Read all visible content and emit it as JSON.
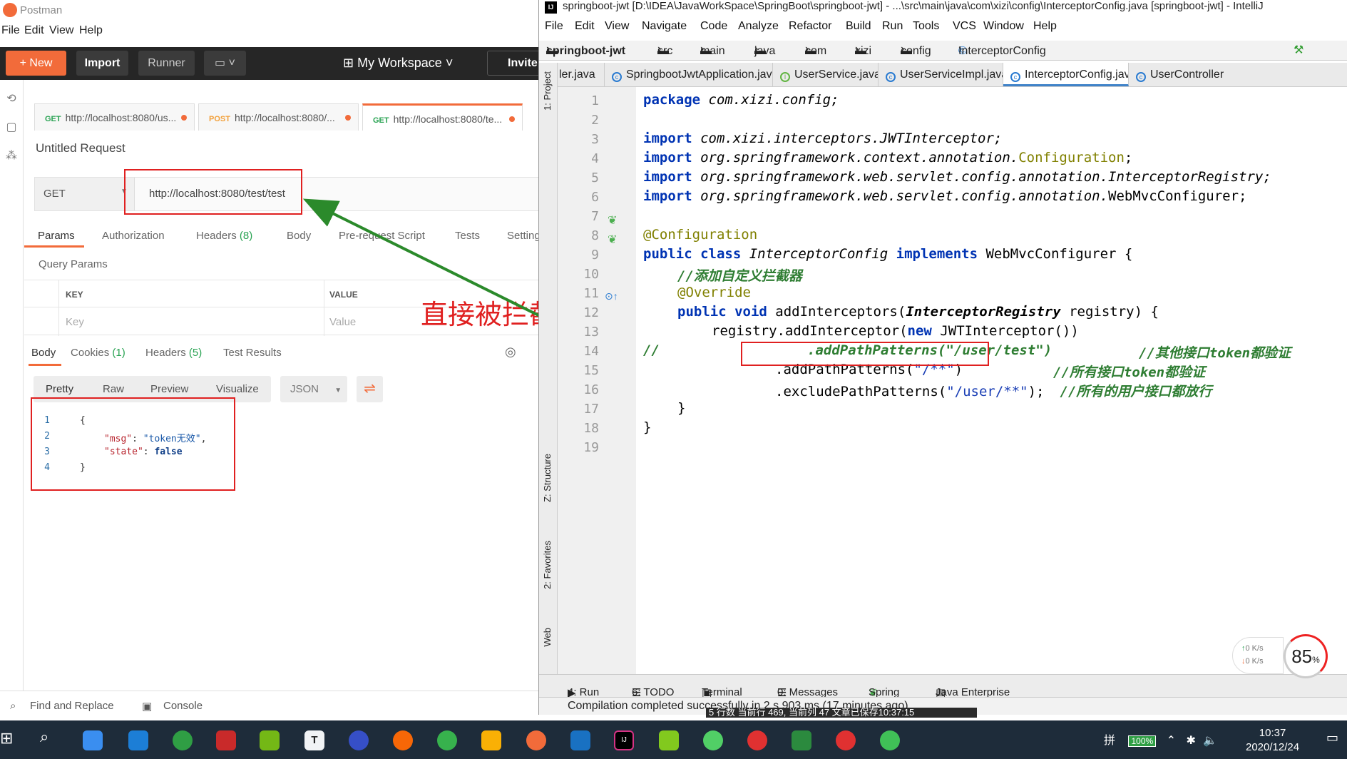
{
  "postman": {
    "app_title": "Postman",
    "menu": [
      "File",
      "Edit",
      "View",
      "Help"
    ],
    "toolbar": {
      "new_label": "New",
      "import_label": "Import",
      "runner_label": "Runner",
      "workspace_label": "My Workspace",
      "invite_label": "Invite"
    },
    "tabs": [
      {
        "method": "GET",
        "url": "http://localhost:8080/us..."
      },
      {
        "method": "POST",
        "url": "http://localhost:8080/..."
      },
      {
        "method": "GET",
        "url": "http://localhost:8080/te..."
      }
    ],
    "request_title": "Untitled Request",
    "method": "GET",
    "url": "http://localhost:8080/test/test",
    "subtabs": [
      "Params",
      "Authorization",
      "Headers",
      "(8)",
      "Body",
      "Pre-request Script",
      "Tests",
      "Settings"
    ],
    "query_params_label": "Query Params",
    "table": {
      "key_header": "KEY",
      "value_header": "VALUE",
      "key_placeholder": "Key",
      "value_placeholder": "Value"
    },
    "response_tabs": {
      "body": "Body",
      "cookies": "Cookies",
      "cookies_count": "(1)",
      "headers": "Headers",
      "headers_count": "(5)",
      "test_results": "Test Results"
    },
    "format_tabs": [
      "Pretty",
      "Raw",
      "Preview",
      "Visualize"
    ],
    "format_select": "JSON",
    "response_lines": [
      {
        "n": "1",
        "text": "{"
      },
      {
        "n": "2",
        "key": "\"msg\"",
        "value": "\"token无效\"",
        "sep": ": ",
        "end": ","
      },
      {
        "n": "3",
        "key": "\"state\"",
        "value": "false",
        "sep": ": ",
        "end": ""
      },
      {
        "n": "4",
        "text": "}"
      }
    ],
    "bottom": {
      "find_replace": "Find and Replace",
      "console": "Console"
    },
    "annotation": "直接被拦截"
  },
  "intellij": {
    "title": "springboot-jwt [D:\\IDEA\\JavaWorkSpace\\SpringBoot\\springboot-jwt] - ...\\src\\main\\java\\com\\xizi\\config\\InterceptorConfig.java [springboot-jwt] - IntelliJ",
    "menu": [
      "File",
      "Edit",
      "View",
      "Navigate",
      "Code",
      "Analyze",
      "Refactor",
      "Build",
      "Run",
      "Tools",
      "VCS",
      "Window",
      "Help"
    ],
    "breadcrumb": [
      "springboot-jwt",
      "src",
      "main",
      "java",
      "com",
      "xizi",
      "config",
      "InterceptorConfig"
    ],
    "tabs": [
      {
        "label": "ler.java"
      },
      {
        "label": "SpringbootJwtApplication.java"
      },
      {
        "label": "UserService.java"
      },
      {
        "label": "UserServiceImpl.java"
      },
      {
        "label": "InterceptorConfig.java",
        "active": true
      },
      {
        "label": "UserController"
      }
    ],
    "side_labels": [
      "1: Project",
      "Z: Structure",
      "2: Favorites",
      "Web"
    ],
    "line_numbers": [
      "1",
      "2",
      "3",
      "4",
      "5",
      "6",
      "7",
      "8",
      "9",
      "10",
      "11",
      "12",
      "13",
      "14",
      "15",
      "16",
      "17",
      "18",
      "19"
    ],
    "code": {
      "l1a": "package",
      "l1b": " com.xizi.config;",
      "imp": "import",
      "l3": " com.xizi.interceptors.JWTInterceptor;",
      "l4a": " org.springframework.context.annotation.",
      "l4b": "Configuration",
      "l4c": ";",
      "l5": " org.springframework.web.servlet.config.annotation.InterceptorRegistry;",
      "l6a": " org.springframework.web.servlet.config.annotation.",
      "l6b": "WebMvcConfigurer;",
      "l8": "@Configuration",
      "l9a": "public class",
      "l9b": " InterceptorConfig ",
      "l9c": "implements",
      "l9d": " WebMvcConfigurer {",
      "l10": "//添加自定义拦截器",
      "l11": "@Override",
      "l12a": "public void",
      "l12b": " addInterceptors(",
      "l12c": "InterceptorRegistry",
      "l12d": " registry) {",
      "l13a": "registry.addInterceptor(",
      "l13b": "new",
      "l13c": " JWTInterceptor())",
      "l14a": "//",
      "l14b": ".addPathPatterns(\"/user/test\")",
      "l14c": "//其他接口token都验证",
      "l15a": ".addPathPatterns(",
      "l15b": "\"/**\"",
      "l15c": ")",
      "l15d": "//所有接口token都验证",
      "l16a": ".excludePathPatterns(",
      "l16b": "\"/user/**\"",
      "l16c": ");",
      "l16d": "//所有的用户接口都放行",
      "l17": "}",
      "l18": "}"
    },
    "bottom_tabs": [
      "4: Run",
      "6: TODO",
      "Terminal",
      "0: Messages",
      "Spring",
      "Java Enterprise"
    ],
    "status": "Compilation completed successfully in 2 s 903 ms (17 minutes ago)"
  },
  "overlay": {
    "speed_up": "0 K/s",
    "speed_down": "0 K/s",
    "gauge": "85",
    "gauge_unit": "%",
    "stray_status": "5 行数  当前行 469, 当前列 47  文章已保存10:37:15"
  },
  "taskbar": {
    "time": "10:37",
    "date": "2020/12/24",
    "battery": "100%"
  }
}
